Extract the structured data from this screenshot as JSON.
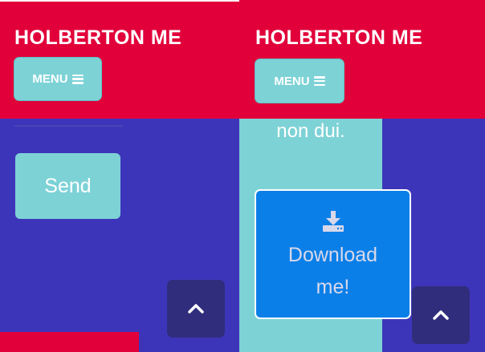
{
  "left_view": {
    "header": {
      "brand": "HOLBERTON ME",
      "menu_label": "MENU"
    },
    "send_label": "Send"
  },
  "right_view": {
    "header": {
      "brand": "HOLBERTON ME",
      "menu_label": "MENU"
    },
    "column_text": "non dui.",
    "download_label": "Download me!"
  },
  "colors": {
    "header_red": "#e1003a",
    "body_purple": "#3d35b9",
    "accent_teal": "#7dd2d6",
    "download_blue": "#0b7fe8",
    "scroll_button": "#312d7d"
  },
  "icons": {
    "menu": "hamburger-icon",
    "scroll_top": "chevron-up-icon",
    "download": "download-icon"
  }
}
